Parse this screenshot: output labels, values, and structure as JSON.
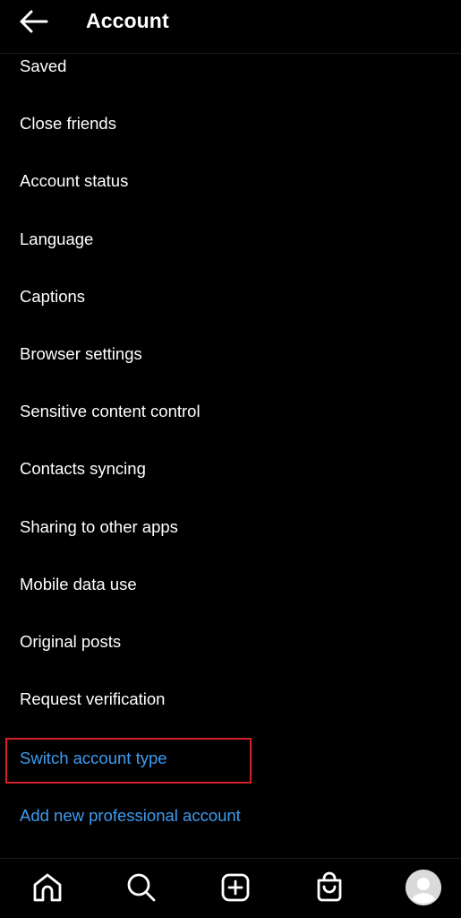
{
  "header": {
    "title": "Account",
    "back_icon": "arrow-left-icon"
  },
  "menu": {
    "items": [
      {
        "label": "Saved"
      },
      {
        "label": "Close friends"
      },
      {
        "label": "Account status"
      },
      {
        "label": "Language"
      },
      {
        "label": "Captions"
      },
      {
        "label": "Browser settings"
      },
      {
        "label": "Sensitive content control"
      },
      {
        "label": "Contacts syncing"
      },
      {
        "label": "Sharing to other apps"
      },
      {
        "label": "Mobile data use"
      },
      {
        "label": "Original posts"
      },
      {
        "label": "Request verification"
      },
      {
        "label": "Switch account type",
        "highlighted": true
      },
      {
        "label": "Add new professional account"
      }
    ]
  },
  "bottom_nav": {
    "items": [
      {
        "icon": "home-icon"
      },
      {
        "icon": "search-icon"
      },
      {
        "icon": "new-post-icon"
      },
      {
        "icon": "shop-icon"
      },
      {
        "icon": "profile-avatar"
      }
    ]
  },
  "colors": {
    "background": "#000000",
    "text": "#ffffff",
    "link": "#3d9cf0",
    "highlight_border": "#d6202b"
  }
}
